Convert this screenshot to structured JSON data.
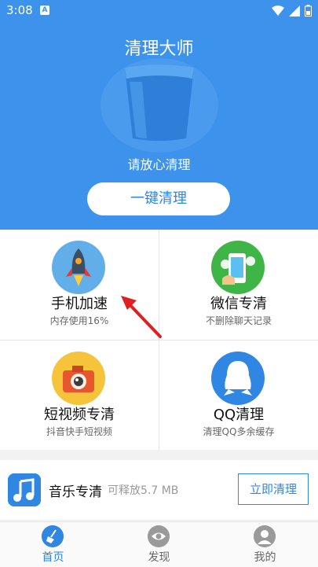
{
  "status_bar": {
    "time": "3:08"
  },
  "header": {
    "title": "清理大师",
    "subtitle": "请放心清理",
    "clean_button": "一键清理"
  },
  "features": [
    {
      "name": "手机加速",
      "desc": "内存使用16%",
      "icon": "rocket-icon"
    },
    {
      "name": "微信专清",
      "desc": "不删除聊天记录",
      "icon": "wechat-clean-icon"
    },
    {
      "name": "短视频专清",
      "desc": "抖音快手短视频",
      "icon": "camera-icon"
    },
    {
      "name": "QQ清理",
      "desc": "清理QQ多余缓存",
      "icon": "qq-icon"
    }
  ],
  "music": {
    "title": "音乐专清",
    "size": "可释放5.7 MB",
    "button": "立即清理",
    "icon": "music-note-icon"
  },
  "tabs": [
    {
      "label": "首页",
      "icon": "broom-icon",
      "active": true
    },
    {
      "label": "发现",
      "icon": "eye-icon",
      "active": false
    },
    {
      "label": "我的",
      "icon": "user-icon",
      "active": false
    }
  ],
  "colors": {
    "primary": "#3d93ec",
    "accent": "#2f86e3",
    "arrow": "#e02020"
  }
}
